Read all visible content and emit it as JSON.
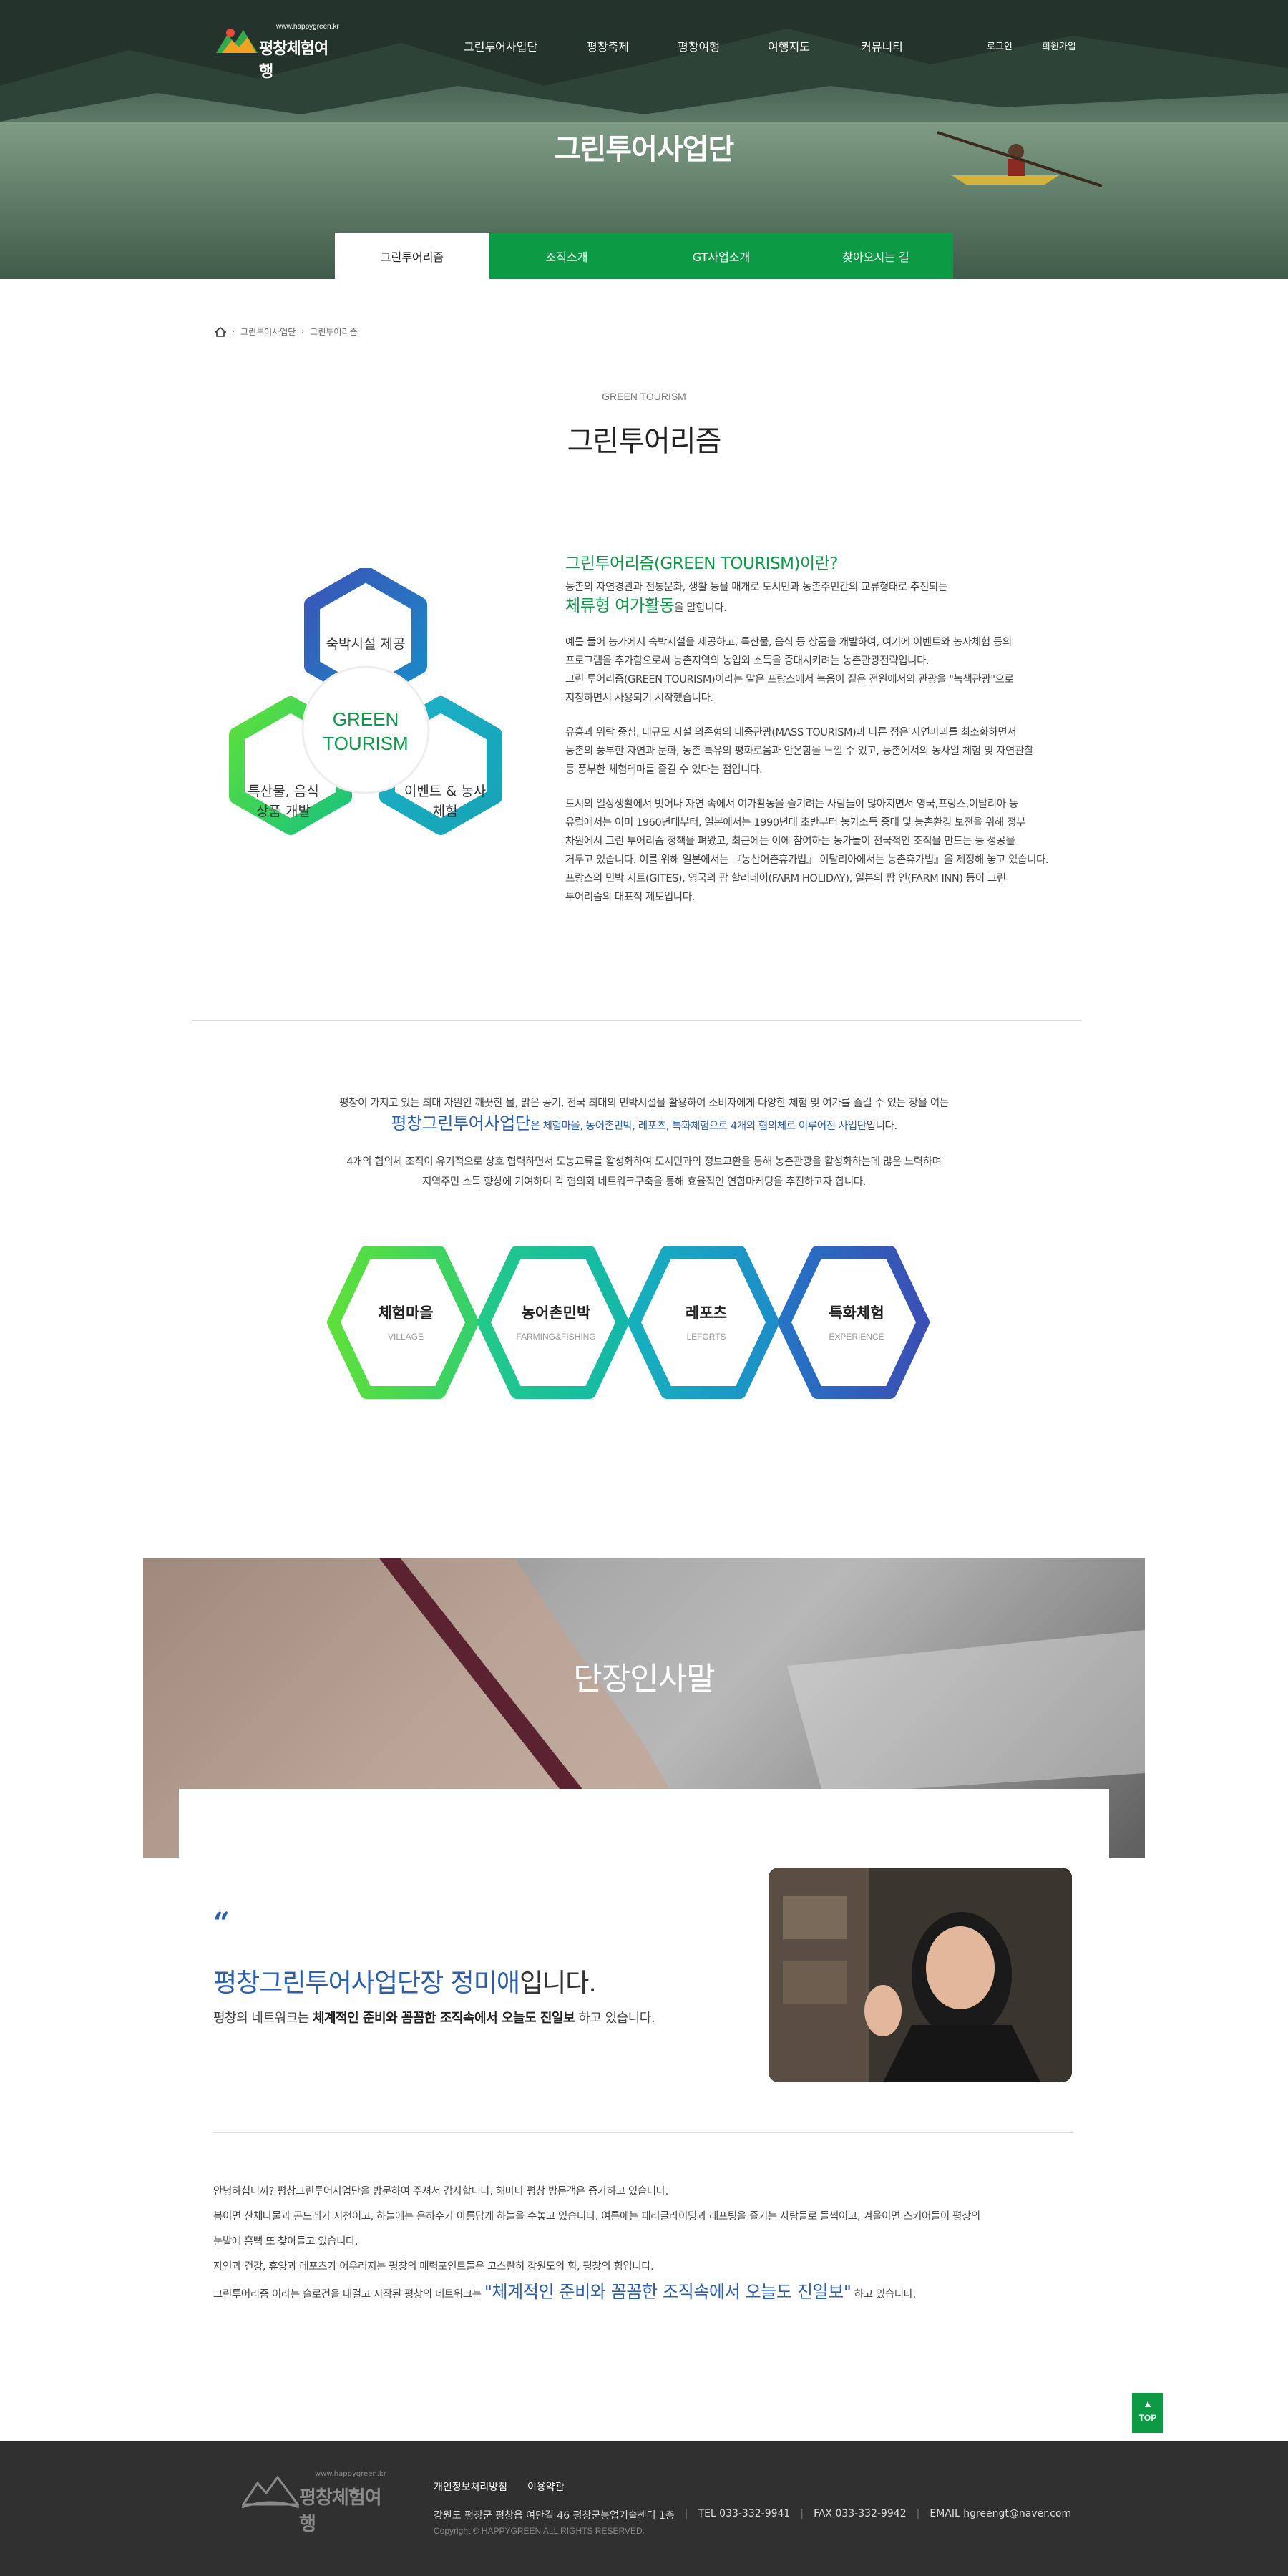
{
  "header": {
    "logo": {
      "url_text": "www.happygreen.kr",
      "name": "평창체험여행"
    },
    "nav": [
      "그린투어사업단",
      "평창축제",
      "평창여행",
      "여행지도",
      "커뮤니티"
    ],
    "util": {
      "login": "로그인",
      "join": "회원가입"
    },
    "hero_title": "그린투어사업단"
  },
  "subtabs": [
    {
      "label": "그린투어리즘",
      "active": true
    },
    {
      "label": "조직소개",
      "active": false
    },
    {
      "label": "GT사업소개",
      "active": false
    },
    {
      "label": "찾아오시는 길",
      "active": false
    }
  ],
  "breadcrumb": {
    "home": "home-icon",
    "level1": "그린투어사업단",
    "level2": "그린투어리즘"
  },
  "page": {
    "eyebrow": "GREEN TOURISM",
    "title": "그린투어리즘"
  },
  "hex_cluster": {
    "center_line1": "GREEN",
    "center_line2": "TOURISM",
    "top": "숙박시설 제공",
    "left_line1": "특산물, 음식",
    "left_line2": "상품 개발",
    "right_line1": "이벤트 & 농사",
    "right_line2": "체험"
  },
  "intro": {
    "heading": "그린투어리즘(GREEN TOURISM)이란?",
    "p1_line1": "농촌의 자연경관과 전통문화, 생활 등을 매개로 도시민과 농촌주민간의 교류형태로 추진되는",
    "p1_hl": "체류형 여가활동",
    "p1_tail": "을 말합니다.",
    "p2_l1": "예를 들어 농가에서 숙박시설을 제공하고, 특산물, 음식 등 상품을 개발하여, 여기에 이벤트와 농사체험 등의",
    "p2_l2": "프로그램을 추가함으로써 농촌지역의 농업외 소득을 증대시키려는 농촌관광전략입니다.",
    "p2_l3": "그린 투어리즘(GREEN TOURISM)이라는 말은 프랑스에서 녹음이 짙은 전원에서의 관광을 \"녹색관광\"으로",
    "p2_l4": "지칭하면서 사용되기 시작했습니다.",
    "p3_l1": "유흥과 위락 중심, 대규모 시설 의존형의 대중관광(MASS TOURISM)과 다른 점은 자연파괴를 최소화하면서",
    "p3_l2": "농촌의 풍부한 자연과 문화, 농촌 특유의 평화로움과 안온함을 느낄 수 있고, 농촌에서의 농사일 체험 및 자연관찰",
    "p3_l3": "등 풍부한 체험테마를 즐길 수 있다는 점입니다.",
    "p4_l1": "도시의 일상생활에서 벗어나 자연 속에서 여가활동을 즐기려는 사람들이 많아지면서 영국,프랑스,이탈리아 등",
    "p4_l2": "유럽에서는 이미 1960년대부터, 일본에서는 1990년대 초반부터 농가소득 증대 및 농촌환경 보전을 위해 정부",
    "p4_l3": "차원에서 그린 투어리즘 정책을 펴왔고, 최근에는 이에 참여하는 농가들이 전국적인 조직을 만드는 등 성공을",
    "p4_l4": "거두고 있습니다. 이를 위해 일본에서는 『농산어촌휴가법』 이탈리아에서는 농촌휴가법』을 제정해 놓고 있습니다.",
    "p4_l5": "프랑스의 민박 지트(GITES), 영국의 팜 할러데이(FARM HOLIDAY), 일본의 팜 인(FARM INN) 등이 그린",
    "p4_l6": "투어리즘의 대표적 제도입니다."
  },
  "network": {
    "l1": "평창이 가지고 있는 최대 자원인 깨끗한 물, 맑은 공기, 전국 최대의 민박시설을 활용하여 소비자에게 다양한 체험 및 여가를 즐길 수 있는 장을 여는",
    "l2_hl": "평창그린투어사업단",
    "l2_mid": "은 체험마을, 농어촌민박, 레포츠, 특화체험으로 4개의 협의체로 이루어진 사업단",
    "l2_tail": "입니다.",
    "l3": "4개의 협의체 조직이 유기적으로 상호 협력하면서 도농교류를 활성화하여 도시민과의 정보교환을 통해 농촌관광을 활성화하는데 많은 노력하며",
    "l4": "지역주민 소득 향상에 기여하며 각 협의회 네트워크구축을 통해 효율적인 연합마케팅을 추진하고자 합니다.",
    "items": [
      {
        "ko": "체험마을",
        "en": "VILLAGE"
      },
      {
        "ko": "농어촌민박",
        "en": "FARMING&FISHING"
      },
      {
        "ko": "레포츠",
        "en": "LEFORTS"
      },
      {
        "ko": "특화체험",
        "en": "EXPERIENCE"
      }
    ]
  },
  "greeting": {
    "banner_title": "단장인사말",
    "quote_mark": "“",
    "name_hl": "평창그린투어사업단장 정미애",
    "name_tail": "입니다.",
    "sub_pre": "평창의 네트워크는 ",
    "sub_bold": "체계적인 준비와 꼼꼼한 조직속에서 오늘도 진일보",
    "sub_tail": " 하고 있습니다.",
    "letter_l1": "안녕하십니까? 평창그린투어사업단을 방문하여 주셔서 감사합니다. 해마다 평창 방문객은 증가하고 있습니다.",
    "letter_l2": "봄이면 산채나물과 곤드레가 지천이고, 하늘에는 은하수가 아름답게 하늘을 수놓고 있습니다. 여름에는 패러글라이딩과 래프팅을 즐기는 사람들로 들썩이고,  겨울이면 스키어들이 평창의",
    "letter_l3": "눈밭에 흠뻑 또 찾아들고 있습니다.",
    "letter_l4": "자연과 건강, 휴양과 레포츠가 어우러지는 평창의 매력포인트들은 고스란히 강원도의 힘, 평창의 힘입니다.",
    "letter_l5_pre": "그린투어리즘 이라는 슬로건을 내걸고 시작된 평창의 네트워크는 ",
    "letter_l5_hl": "\"체계적인 준비와 꼼꼼한 조직속에서 오늘도 진일보\"",
    "letter_l5_tail": " 하고 있습니다."
  },
  "top_button": "TOP",
  "footer": {
    "logo_url": "www.happygreen.kr",
    "logo_name": "평창체험여행",
    "links": [
      "개인정보처리방침",
      "이용약관"
    ],
    "address": "강원도 평창군 평창읍 여만길 46 평창군농업기술센터 1층",
    "tel": "TEL 033-332-9941",
    "fax": "FAX 033-332-9942",
    "email": "EMAIL hgreengt@naver.com",
    "copyright": "Copyright © HAPPYGREEN ALL RIGHTS RESERVED."
  },
  "colors": {
    "green": "#0d9a45",
    "blue": "#2a5fb0",
    "footer": "#303030"
  }
}
